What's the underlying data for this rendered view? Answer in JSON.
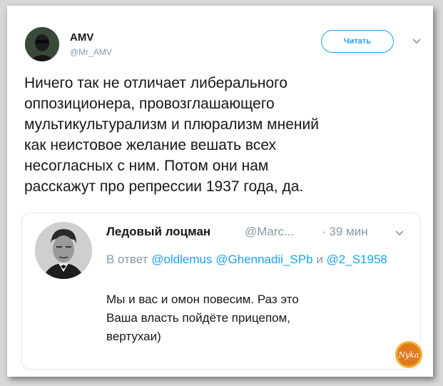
{
  "tweet": {
    "author_name": "AMV",
    "author_handle": "@Mr_AMV",
    "follow_label": "Читать",
    "text": "Ничего так не отличает либерального\nоппозиционера, провозглашающего\nмультикультурализм и плюрализм мнений\nкак неистовое желание вешать всех\nнесогласных с ним. Потом они нам\nрасскажут про репрессии 1937 года, да.",
    "menu_icon": "chevron-down-icon"
  },
  "quoted": {
    "author_name": "Ледовый лоцман",
    "author_handle": "@Marc...",
    "time": "· 39 мин",
    "reply_prefix": "В ответ",
    "mentions": [
      "@oldlemus",
      "@Ghennadii_SPb",
      "@2_S1958"
    ],
    "mention_joiner": "и",
    "text": "Мы и вас и омон  повесим. Раз это\nВаша власть пойдёте прицепом,\nвертухаи)"
  },
  "watermark": {
    "label": "Nyka"
  },
  "colors": {
    "link": "#1da1f2",
    "secondary": "#8899a6",
    "text": "#14171a"
  }
}
